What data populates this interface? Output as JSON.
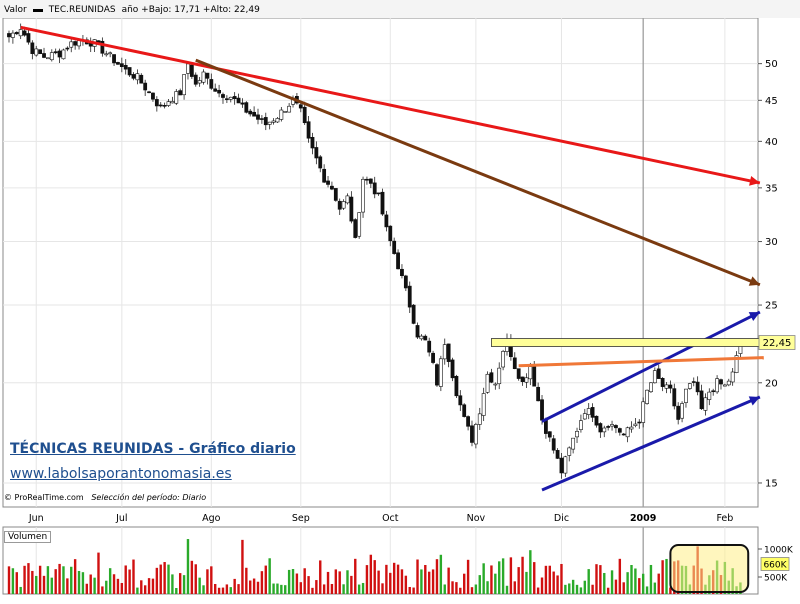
{
  "header": {
    "left_label": "Valor",
    "ticker": "TEC.REUNIDAS",
    "stats": "año +Bajo: 17,71 +Alto: 22,49"
  },
  "overlay": {
    "title": "TÉCNICAS REUNIDAS - Gráfico diario",
    "website": "www.labolsaporantonomasia.es",
    "source": "ProRealTime.com",
    "period": "Selección del período: Diario"
  },
  "volume_panel": {
    "label": "Volumen",
    "ticks": [
      "1000K",
      "500K"
    ],
    "current": "660K"
  },
  "colors": {
    "up": "#2aaa2a",
    "down": "#d01010",
    "line_red": "#e81818",
    "line_brown": "#7a3a10",
    "channel_blue": "#1a1aaa",
    "support_orange": "#f07838",
    "resistance_yellow": "#ffff99",
    "highlight_box": "#ffee88"
  },
  "chart_data": {
    "type": "candlestick",
    "title": "TÉCNICAS REUNIDAS - Gráfico diario",
    "xlabel": "",
    "ylabel": "",
    "scale": "log",
    "ylim": [
      14,
      57
    ],
    "y_ticks": [
      15,
      20,
      25,
      30,
      35,
      40,
      45,
      50
    ],
    "x_tick_labels": [
      "Jun",
      "Jul",
      "Ago",
      "Sep",
      "Oct",
      "Nov",
      "Dic",
      "2009",
      "Feb"
    ],
    "x_tick_index": [
      7,
      29,
      52,
      75,
      98,
      120,
      142,
      163,
      184
    ],
    "year_separator_index": 163,
    "last_price_label": "22,45",
    "ohlc_keypoints": [
      [
        0,
        54
      ],
      [
        3,
        55.5
      ],
      [
        6,
        52
      ],
      [
        9,
        51
      ],
      [
        13,
        51.5
      ],
      [
        16,
        53
      ],
      [
        19,
        53.5
      ],
      [
        22,
        53
      ],
      [
        26,
        51
      ],
      [
        30,
        49
      ],
      [
        33,
        48
      ],
      [
        36,
        46
      ],
      [
        39,
        44
      ],
      [
        41,
        45
      ],
      [
        44,
        46
      ],
      [
        46,
        50
      ],
      [
        48,
        47
      ],
      [
        50,
        48.5
      ],
      [
        52,
        47
      ],
      [
        54,
        46
      ],
      [
        57,
        45.5
      ],
      [
        60,
        44
      ],
      [
        63,
        43
      ],
      [
        66,
        42
      ],
      [
        69,
        43
      ],
      [
        71,
        44
      ],
      [
        73,
        45
      ],
      [
        75,
        43.5
      ],
      [
        77,
        40
      ],
      [
        79,
        38
      ],
      [
        81,
        36
      ],
      [
        83,
        35
      ],
      [
        85,
        33
      ],
      [
        87,
        34
      ],
      [
        89,
        30
      ],
      [
        91,
        36
      ],
      [
        93,
        35.5
      ],
      [
        95,
        34
      ],
      [
        97,
        31
      ],
      [
        99,
        29
      ],
      [
        101,
        27
      ],
      [
        103,
        25
      ],
      [
        105,
        23
      ],
      [
        107,
        22.5
      ],
      [
        109,
        21
      ],
      [
        110,
        20
      ],
      [
        112,
        22.5
      ],
      [
        113,
        21.5
      ],
      [
        115,
        19.5
      ],
      [
        117,
        18
      ],
      [
        119,
        17
      ],
      [
        121,
        18.5
      ],
      [
        123,
        20.5
      ],
      [
        125,
        20
      ],
      [
        126,
        21
      ],
      [
        127,
        22
      ],
      [
        128,
        22.5
      ],
      [
        130,
        21
      ],
      [
        132,
        20
      ],
      [
        134,
        21
      ],
      [
        135,
        20
      ],
      [
        137,
        18
      ],
      [
        139,
        17
      ],
      [
        141,
        16
      ],
      [
        142,
        15.5
      ],
      [
        144,
        16.5
      ],
      [
        146,
        17.5
      ],
      [
        148,
        18.5
      ],
      [
        150,
        18.3
      ],
      [
        152,
        17.5
      ],
      [
        154,
        17.8
      ],
      [
        156,
        17.6
      ],
      [
        158,
        17.2
      ],
      [
        160,
        17.6
      ],
      [
        162,
        18
      ],
      [
        164,
        19.5
      ],
      [
        166,
        20.5
      ],
      [
        168,
        19.8
      ],
      [
        170,
        19.5
      ],
      [
        172,
        18
      ],
      [
        174,
        19.5
      ],
      [
        176,
        20
      ],
      [
        178,
        18.5
      ],
      [
        180,
        19.5
      ],
      [
        182,
        20
      ],
      [
        184,
        19.8
      ],
      [
        186,
        20.5
      ],
      [
        188,
        22.45
      ]
    ],
    "trendlines": [
      {
        "color": "red",
        "start": [
          3,
          55.5
        ],
        "end": [
          193,
          35.5
        ],
        "arrow": true
      },
      {
        "color": "brown",
        "start": [
          48,
          50.5
        ],
        "end": [
          193,
          26.5
        ],
        "arrow": true
      },
      {
        "color": "blue",
        "start": [
          137,
          17.9
        ],
        "end": [
          193,
          24.5
        ],
        "arrow": true
      },
      {
        "color": "blue",
        "start": [
          137,
          14.7
        ],
        "end": [
          193,
          19.2
        ],
        "arrow": true
      },
      {
        "color": "orange",
        "start": [
          131,
          21
        ],
        "end": [
          194,
          21.5
        ],
        "arrow": false
      },
      {
        "color": "yellow",
        "start": [
          124,
          22.1
        ],
        "end": [
          194,
          22.45
        ],
        "arrow": false,
        "band": true
      }
    ]
  }
}
